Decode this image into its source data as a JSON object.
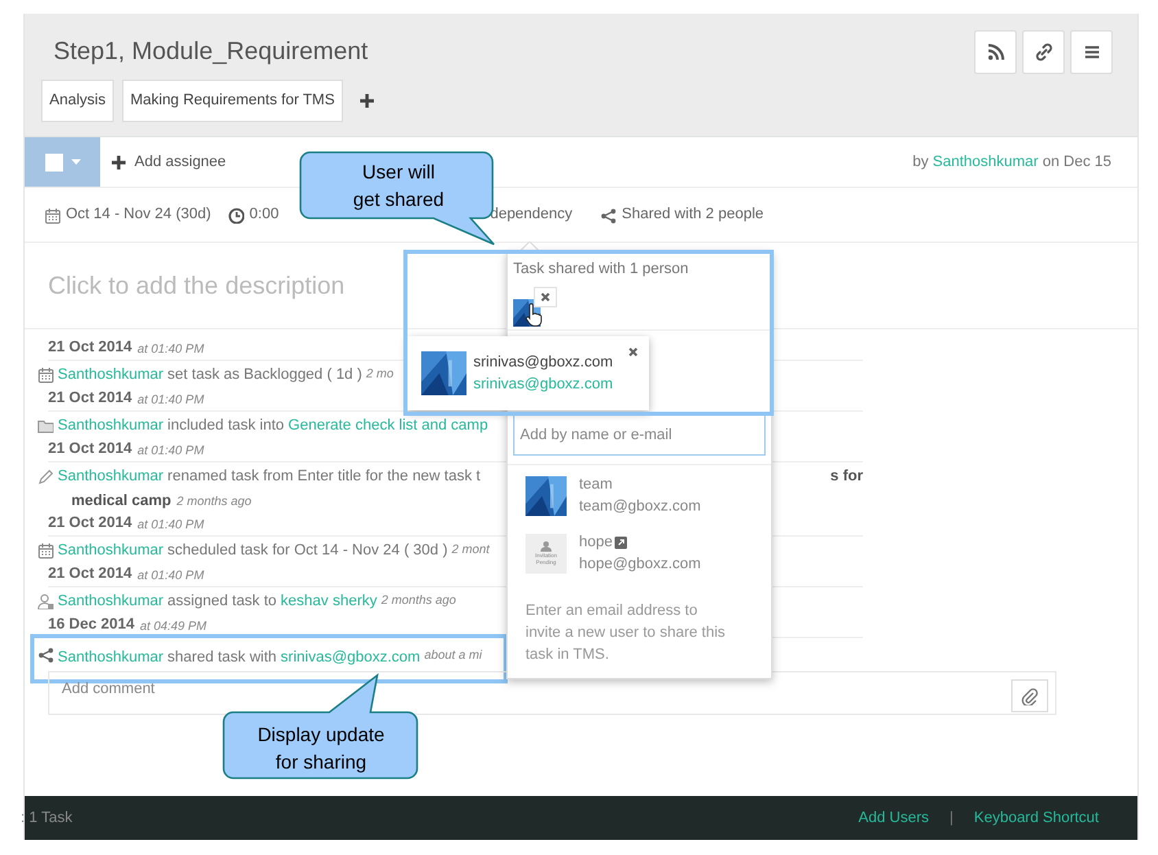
{
  "task": {
    "title": "Step1, Module_Requirement",
    "tags": [
      "Analysis",
      "Making Requirements for TMS"
    ]
  },
  "header_buttons": [
    {
      "kind": "rss"
    },
    {
      "kind": "link"
    },
    {
      "kind": "menu"
    }
  ],
  "toolbar": {
    "assignee_label": "Add assignee",
    "by": "by",
    "author": "Santhoshkumar",
    "on": "on Dec 15"
  },
  "meta": [
    {
      "kind": "calendar",
      "text": "Oct 14 - Nov 24 (30d)"
    },
    {
      "kind": "clock",
      "text": "0:00"
    },
    {
      "kind": "partial",
      "text": "dependency"
    },
    {
      "kind": "share",
      "text": "Shared with 2 people"
    }
  ],
  "description_placeholder": "Click to add the description",
  "activity": [
    {
      "date": "21 Oct 2014",
      "time": "at 01:40 PM",
      "kind": "calendar",
      "highlighted": false,
      "parts": [
        {
          "kind": "user",
          "text": "Santhoshkumar"
        },
        {
          "kind": "text",
          "text": "set task as Backlogged ( 1d )"
        },
        {
          "kind": "time",
          "text": "2 mo"
        }
      ]
    },
    {
      "date": "21 Oct 2014",
      "time": "at 01:40 PM",
      "kind": "folder",
      "highlighted": false,
      "parts": [
        {
          "kind": "user",
          "text": "Santhoshkumar"
        },
        {
          "kind": "text",
          "text": "included task into"
        },
        {
          "kind": "link",
          "text": "Generate check list and camp"
        }
      ]
    },
    {
      "date": "21 Oct 2014",
      "time": "at 01:40 PM",
      "kind": "pencil",
      "highlighted": false,
      "parts": [
        {
          "kind": "user",
          "text": "Santhoshkumar"
        },
        {
          "kind": "text",
          "text": "renamed task from Enter title for the new task t"
        },
        {
          "kind": "right",
          "text": "s for"
        }
      ],
      "second_line": [
        {
          "kind": "bold",
          "text": "medical camp"
        },
        {
          "kind": "time",
          "text": "2 months ago"
        }
      ]
    },
    {
      "date": "21 Oct 2014",
      "time": "at 01:40 PM",
      "kind": "calendar",
      "highlighted": false,
      "parts": [
        {
          "kind": "user",
          "text": "Santhoshkumar"
        },
        {
          "kind": "text",
          "text": "scheduled task for Oct 14 - Nov 24 ( 30d )"
        },
        {
          "kind": "time",
          "text": "2 mont"
        }
      ]
    },
    {
      "date": "21 Oct 2014",
      "time": "at 01:40 PM",
      "kind": "user",
      "highlighted": false,
      "parts": [
        {
          "kind": "user",
          "text": "Santhoshkumar"
        },
        {
          "kind": "text",
          "text": "assigned task to"
        },
        {
          "kind": "link",
          "text": "keshav sherky"
        },
        {
          "kind": "time",
          "text": "2 months ago"
        }
      ]
    },
    {
      "date": "16 Dec 2014",
      "time": "at 04:49 PM",
      "kind": "share",
      "highlighted": true,
      "parts": [
        {
          "kind": "user",
          "text": "Santhoshkumar"
        },
        {
          "kind": "text",
          "text": "shared task with"
        },
        {
          "kind": "link",
          "text": "srinivas@gboxz.com"
        },
        {
          "kind": "time",
          "text": "about a mi"
        }
      ]
    }
  ],
  "comment_placeholder": "Add comment",
  "share_popup": {
    "heading": "Task shared with 1 person",
    "highlighted": true,
    "search_placeholder": "Add by name or e-mail",
    "suggestions": [
      {
        "name": "team",
        "email": "team@gboxz.com"
      },
      {
        "kind": "pending",
        "name": "hope",
        "email": "hope@gboxz.com",
        "badge": "Invitation Pending"
      }
    ],
    "hint": "Enter an email address to invite a new user to share this task in TMS."
  },
  "user_card": {
    "name": "srinivas@gboxz.com",
    "email": "srinivas@gboxz.com"
  },
  "footer": {
    "count": ": 1 Task",
    "links": [
      "Add Users",
      "Keyboard Shortcut"
    ],
    "separator": "|"
  },
  "callouts": [
    {
      "text": "User will get shared"
    },
    {
      "text": "Display update for sharing"
    }
  ]
}
